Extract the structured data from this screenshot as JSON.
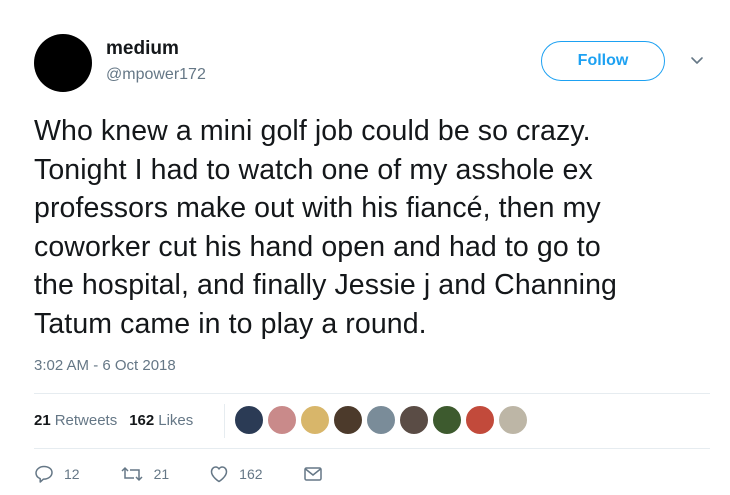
{
  "user": {
    "name": "medium",
    "handle": "@mpower172"
  },
  "follow_label": "Follow",
  "tweet": {
    "lines": [
      "Who knew a mini golf job could be so crazy.",
      "Tonight I had to watch one of my asshole ex",
      "professors make out with his fiancé, then my",
      "coworker cut his hand open and had to go to",
      "the hospital, and finally Jessie j and Channing",
      "Tatum came in to play a round."
    ]
  },
  "timestamp": "3:02 AM - 6 Oct 2018",
  "stats": {
    "retweets_count": "21",
    "retweets_label": "Retweets",
    "likes_count": "162",
    "likes_label": "Likes"
  },
  "likers": [
    {
      "color": "#2b3b55"
    },
    {
      "color": "#c98a8a"
    },
    {
      "color": "#d8b66a"
    },
    {
      "color": "#4c3a2b"
    },
    {
      "color": "#7a8c99"
    },
    {
      "color": "#5a4c45"
    },
    {
      "color": "#3d5a2e"
    },
    {
      "color": "#c24a3b"
    },
    {
      "color": "#bdb6a6"
    }
  ],
  "actions": {
    "replies": "12",
    "retweets": "21",
    "likes": "162"
  },
  "colors": {
    "accent": "#1da1f2",
    "muted": "#657786"
  }
}
